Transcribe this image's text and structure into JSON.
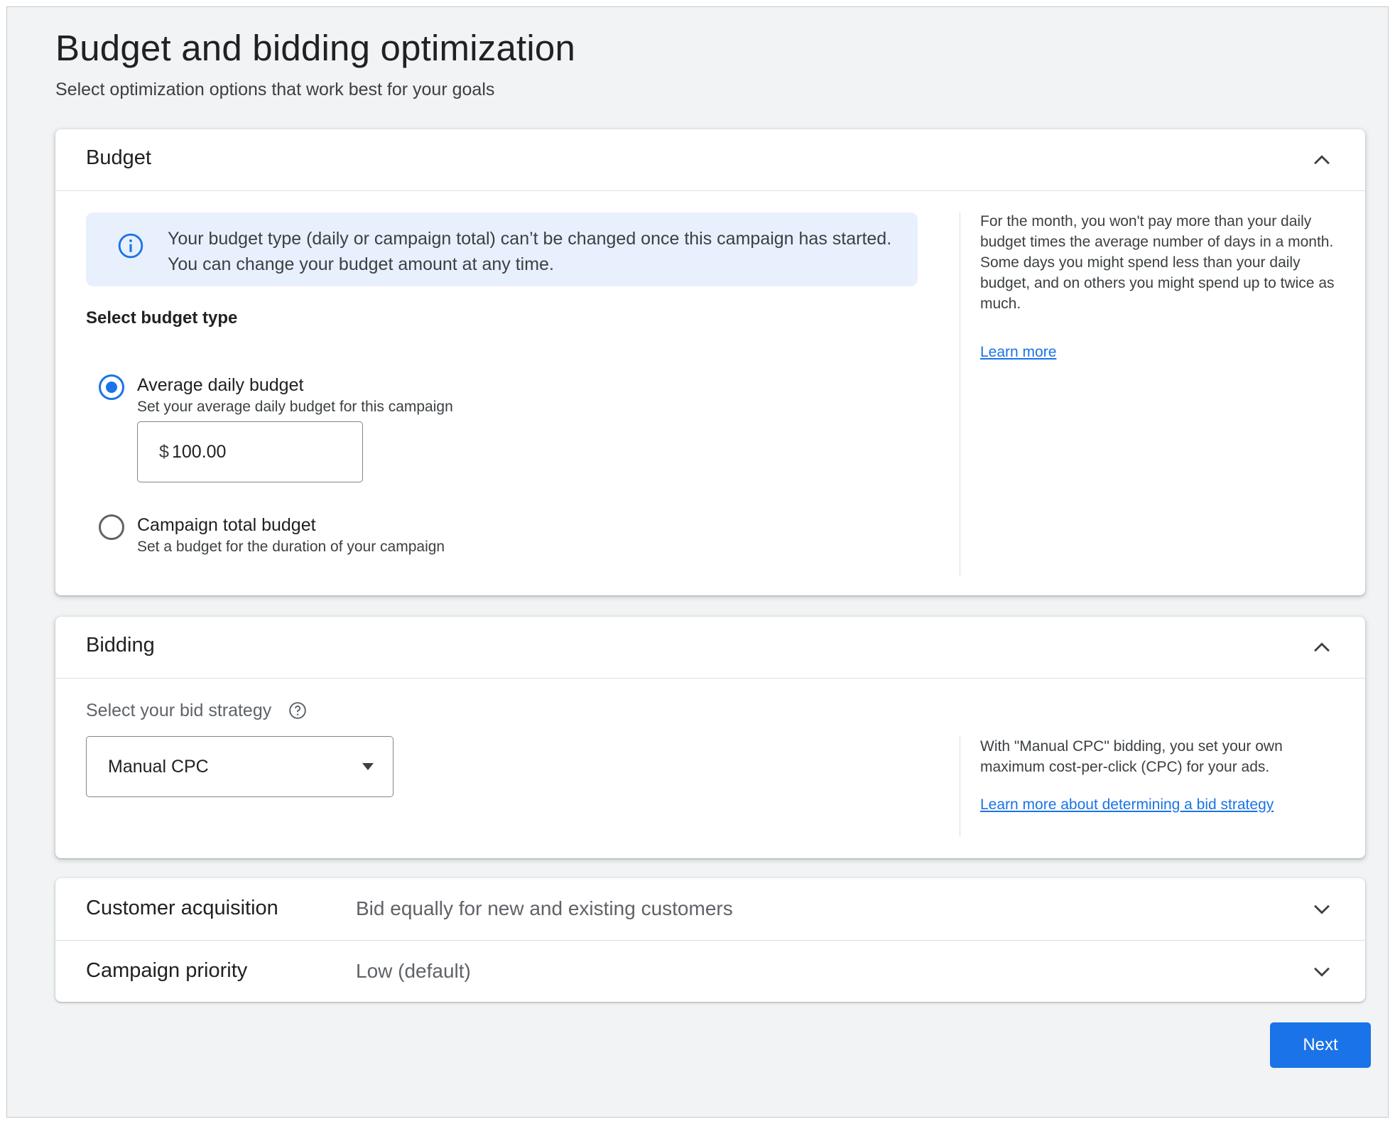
{
  "page": {
    "title": "Budget and bidding optimization",
    "subtitle": "Select optimization options that work best for your goals"
  },
  "budget": {
    "title": "Budget",
    "expanded": true,
    "info_banner": "Your budget type (daily or campaign total) can’t be changed once this campaign has started. You can change your budget amount at any time.",
    "select_label": "Select budget type",
    "options": [
      {
        "label": "Average daily budget",
        "description": "Set your average daily budget for this campaign",
        "selected": true
      },
      {
        "label": "Campaign total budget",
        "description": "Set a budget for the duration of your campaign",
        "selected": false
      }
    ],
    "amount": {
      "currency": "$",
      "value": "100.00"
    },
    "side_help": "For the month, you won't pay more than your daily budget times the average number of days in a month. Some days you might spend less than your daily budget, and on others you might spend up to twice as much.",
    "side_link": "Learn more"
  },
  "bidding": {
    "title": "Bidding",
    "expanded": true,
    "strategy_label": "Select your bid strategy",
    "strategy_value": "Manual CPC",
    "side_help": "With \"Manual CPC\" bidding, you set your own maximum cost-per-click (CPC) for your ads.",
    "side_link": "Learn more about determining a bid strategy"
  },
  "collapsed_sections": [
    {
      "title": "Customer acquisition",
      "value": "Bid equally for new and existing customers",
      "expanded": false
    },
    {
      "title": "Campaign priority",
      "value": "Low (default)",
      "expanded": false
    }
  ],
  "actions": {
    "next_label": "Next"
  },
  "colors": {
    "primary": "#1a73e8",
    "background": "#f1f3f4",
    "info_banner": "#e8f0fe"
  },
  "icons": {
    "info": "info-icon",
    "help": "help-icon",
    "collapse": "chevron-up-icon",
    "expand": "chevron-down-icon",
    "dropdown": "dropdown-arrow-icon"
  }
}
